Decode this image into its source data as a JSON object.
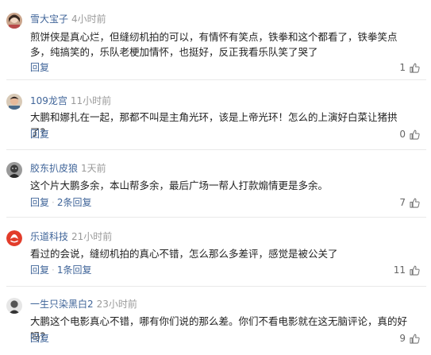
{
  "labels": {
    "reply": "回复",
    "sep": "·"
  },
  "comments": [
    {
      "username": "雪大宝子",
      "time": "4小时前",
      "content": "煎饼侠是真心烂，但缝纫机拍的可以，有情怀有笑点，铁拳和这个都看了，铁拳笑点多，纯搞笑的，乐队老梗加情怀，也挺好，反正我看乐队笑了哭了",
      "likes": "1",
      "replies": "",
      "avatar": "girl-avatar"
    },
    {
      "username": "109龙宫",
      "time": "11小时前",
      "content": "大鹏和娜扎在一起，那都不叫是主角光环，该是上帝光环！怎么的上演好白菜让猪拱了？",
      "likes": "0",
      "replies": "",
      "avatar": "man-avatar"
    },
    {
      "username": "胶东扒皮狼",
      "time": "1天前",
      "content": "这个片大鹏多余，本山帮多余，最后广场一帮人打款煽情更是多余。",
      "likes": "7",
      "replies": "2条回复",
      "avatar": "dark-avatar"
    },
    {
      "username": "乐道科技",
      "time": "21小时前",
      "content": "看过的会说，缝纫机拍的真心不错，怎么那么多差评，感觉是被公关了",
      "likes": "11",
      "replies": "1条回复",
      "avatar": "logo-avatar"
    },
    {
      "username": "一生只染黑白2",
      "time": "23小时前",
      "content": "大鹏这个电影真心不错，哪有你们说的那么差。你们不看电影就在这无脑评论，真的好吗？",
      "likes": "9",
      "replies": "",
      "avatar": "bw-avatar"
    }
  ],
  "colors": {
    "username": "#406599",
    "time": "#9a9a9a",
    "text": "#222222",
    "divider": "#e9e9e9"
  }
}
